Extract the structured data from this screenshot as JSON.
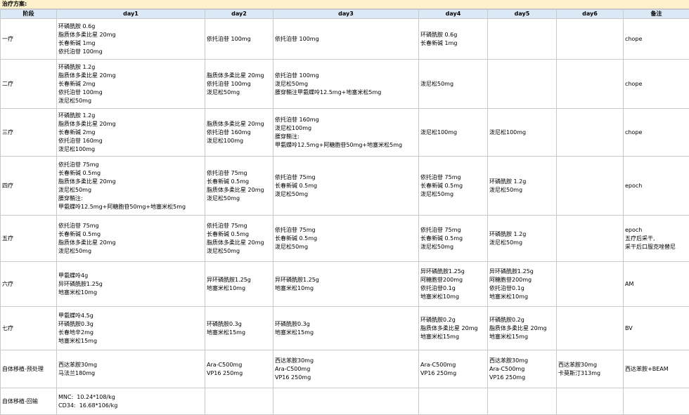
{
  "title": "治疗方案:",
  "headers": [
    "阶段",
    "day1",
    "day2",
    "day3",
    "day4",
    "day5",
    "day6",
    "备注"
  ],
  "rows": [
    {
      "stage": "一疗",
      "cells": [
        [
          "环磷酰胺 0.6g",
          "脂质体多柔比星 20mg",
          "长春新碱 1mg",
          "依托泊苷 100mg"
        ],
        [
          "依托泊苷 100mg"
        ],
        [
          "依托泊苷 100mg"
        ],
        [
          "环磷酰胺 0.6g",
          "长春新碱 1mg"
        ],
        [],
        [],
        [
          "chope"
        ]
      ]
    },
    {
      "stage": "二疗",
      "cells": [
        [
          "环磷酰胺 1.2g",
          "脂质体多柔比星 20mg",
          "长春新碱 2mg",
          "依托泊苷 100mg",
          "泼尼松50mg"
        ],
        [
          "脂质体多柔比星 20mg",
          "依托泊苷 100mg",
          "泼尼松50mg"
        ],
        [
          "依托泊苷 100mg",
          "泼尼松50mg",
          "腰穿鞘注甲氨蝶呤12.5mg+地塞米松5mg"
        ],
        [
          "泼尼松50mg"
        ],
        [],
        [],
        [
          "chope"
        ]
      ]
    },
    {
      "stage": "三疗",
      "cells": [
        [
          "环磷酰胺 1.2g",
          "脂质体多柔比星 20mg",
          "长春新碱 2mg",
          "依托泊苷 160mg",
          "泼尼松100mg"
        ],
        [
          "脂质体多柔比星 20mg",
          "依托泊苷 160mg",
          "泼尼松100mg"
        ],
        [
          "依托泊苷 160mg",
          "泼尼松100mg",
          "腰穿鞘注:",
          "甲氨蝶呤12.5mg+阿糖胞苷50mg+地塞米松5mg"
        ],
        [
          "泼尼松100mg"
        ],
        [
          "泼尼松100mg"
        ],
        [],
        [
          "chope"
        ]
      ]
    },
    {
      "stage": "四疗",
      "cells": [
        [
          "依托泊苷 75mg",
          "长春新碱 0.5mg",
          "脂质体多柔比星 20mg",
          "泼尼松50mg",
          "腰穿鞘注:",
          "甲氨蝶呤12.5mg+阿糖胞苷50mg+地塞米松5mg"
        ],
        [
          "依托泊苷 75mg",
          "长春新碱 0.5mg",
          "脂质体多柔比星 20mg",
          "泼尼松50mg"
        ],
        [
          "依托泊苷 75mg",
          "长春新碱 0.5mg",
          "泼尼松50mg"
        ],
        [
          "依托泊苷 75mg",
          "长春新碱 0.5mg",
          "泼尼松50mg"
        ],
        [
          "环磷酰胺 1.2g",
          "泼尼松50mg"
        ],
        [],
        [
          "epoch"
        ]
      ]
    },
    {
      "stage": "五疗",
      "cells": [
        [
          "依托泊苷 75mg",
          "长春新碱 0.5mg",
          "脂质体多柔比星 20mg",
          "泼尼松50mg"
        ],
        [
          "依托泊苷 75mg",
          "长春新碱 0.5mg",
          "脂质体多柔比星 20mg",
          "泼尼松50mg"
        ],
        [
          "依托泊苷 75mg",
          "长春新碱 0.5mg",
          "泼尼松50mg"
        ],
        [
          "依托泊苷 75mg",
          "长春新碱 0.5mg",
          "泼尼松50mg"
        ],
        [
          "环磷酰胺 1.2g",
          "泼尼松50mg"
        ],
        [],
        [
          "epoch",
          "五疗后采干,",
          "采干后口服克唑替尼"
        ]
      ]
    },
    {
      "stage": "六疗",
      "cells": [
        [
          "甲氨蝶呤4g",
          "异环磷酰胺1.25g",
          "地塞米松10mg"
        ],
        [
          "异环磷酰胺1.25g",
          "地塞米松10mg"
        ],
        [
          "异环磷酰胺1.25g",
          "地塞米松10mg"
        ],
        [
          "异环磷酰胺1.25g",
          "阿糖胞苷200mg",
          "依托泊苷0.1g",
          "地塞米松10mg"
        ],
        [
          "异环磷酰胺1.25g",
          "阿糖胞苷200mg",
          "依托泊苷0.1g",
          "地塞米松10mg"
        ],
        [],
        [
          "AM"
        ]
      ]
    },
    {
      "stage": "七疗",
      "cells": [
        [
          "甲氨蝶呤4.5g",
          "环磷酰胺0.3g",
          "长春地辛2mg",
          "地塞米松15mg"
        ],
        [
          "环磷酰胺0.3g",
          "地塞米松15mg"
        ],
        [
          "环磷酰胺0.3g",
          "地塞米松15mg"
        ],
        [
          "环磷酰胺0.2g",
          "脂质体多柔比星 20mg",
          "地塞米松15mg"
        ],
        [
          "环磷酰胺0.2g",
          "脂质体多柔比星 20mg",
          "地塞米松15mg"
        ],
        [],
        [
          "BV"
        ]
      ]
    },
    {
      "stage": "自体移植-预处理",
      "cells": [
        [
          "西达苯胺30mg",
          "马法兰180mg"
        ],
        [
          "Ara-C500mg",
          "VP16 250mg"
        ],
        [
          "西达苯胺30mg",
          "Ara-C500mg",
          "VP16 250mg"
        ],
        [
          "Ara-C500mg",
          "VP16 250mg"
        ],
        [
          "西达苯胺30mg",
          "Ara-C500mg",
          "VP16 250mg"
        ],
        [
          "西达苯胺30mg",
          "卡莫斯汀313mg"
        ],
        [
          "西达苯胺+BEAM"
        ]
      ]
    },
    {
      "stage": "自体移植-回输",
      "cells": [
        [
          "MNC:  10.24*108/kg",
          "CD34:  16.68*106/kg"
        ],
        [],
        [],
        [],
        [],
        [],
        []
      ]
    }
  ]
}
